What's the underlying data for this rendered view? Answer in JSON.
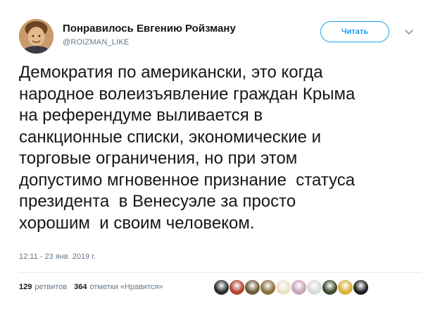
{
  "account": {
    "display_name": "Понравилось Евгению Ройзману",
    "handle": "@ROIZMAN_LIKE"
  },
  "follow_button": {
    "label": "Читать"
  },
  "menu": {
    "icon": "chevron-down-icon"
  },
  "tweet": {
    "text": "Демократия по американски, это когда\nнародное волеизъявление граждан Крыма\nна референдуме выливается в\nсанкционные списки, экономические и\nторговые ограничения, но при этом\nдопустимо мгновенное признание  статуса\nпрезидента  в Венесуэле за просто\nхорошим  и своим человеком.",
    "timestamp": "12:11 - 23 янв. 2019 г."
  },
  "stats": {
    "retweets_count": "129",
    "retweets_label": "ретвитов",
    "likes_count": "364",
    "likes_label": "отметки «Нравится»"
  },
  "likers": [
    {
      "color": "#2b2b2b"
    },
    {
      "color": "#b0462e"
    },
    {
      "color": "#6b5a3a"
    },
    {
      "color": "#8b6f3e"
    },
    {
      "color": "#e7e2c9"
    },
    {
      "color": "#c7a3b8"
    },
    {
      "color": "#d9d9d9"
    },
    {
      "color": "#3e4a2e"
    },
    {
      "color": "#d8b23a"
    },
    {
      "color": "#1e1e1e"
    }
  ],
  "colors": {
    "accent": "#1da1f2",
    "text": "#14171a",
    "secondary": "#657786"
  }
}
